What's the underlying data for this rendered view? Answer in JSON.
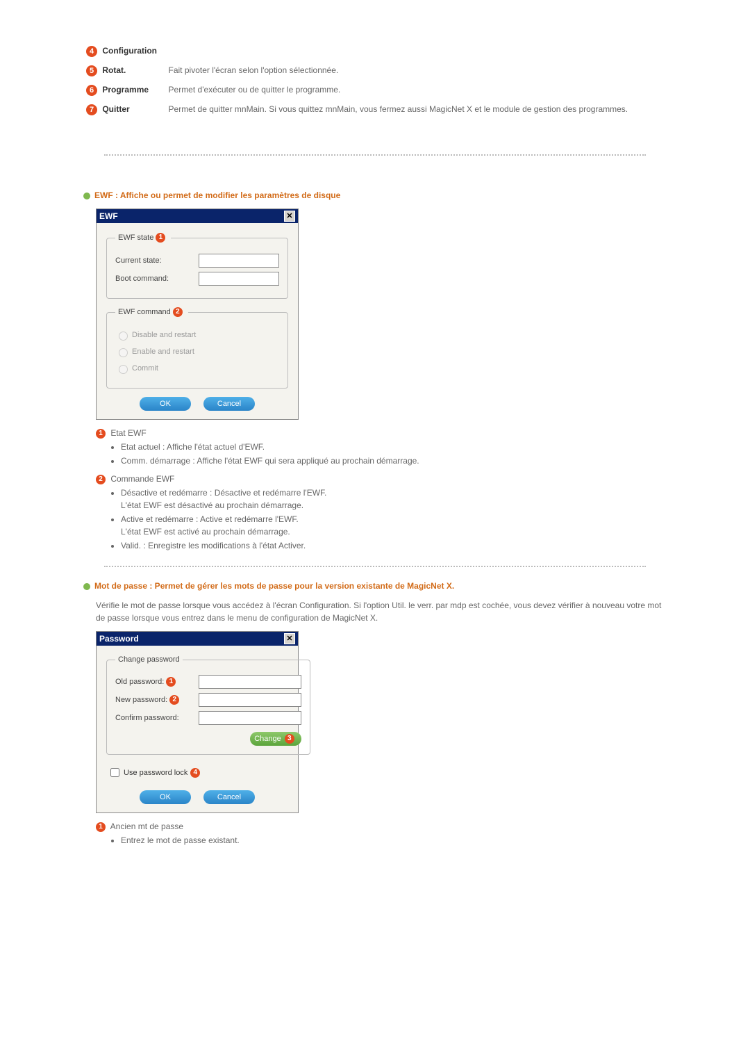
{
  "items": {
    "i4": {
      "num": "4",
      "label": "Configuration",
      "desc": ""
    },
    "i5": {
      "num": "5",
      "label": "Rotat.",
      "desc": "Fait pivoter l'écran selon l'option sélectionnée."
    },
    "i6": {
      "num": "6",
      "label": "Programme",
      "desc": "Permet d'exécuter ou de quitter le programme."
    },
    "i7": {
      "num": "7",
      "label": "Quitter",
      "desc": "Permet de quitter mnMain. Si vous quittez mnMain, vous fermez aussi MagicNet X et le module de gestion des programmes."
    }
  },
  "ewf": {
    "heading": "EWF : Affiche ou permet de modifier les paramètres de disque",
    "dialog": {
      "title": "EWF",
      "close_glyph": "✕",
      "group_state": {
        "legend": "EWF state",
        "legend_badge": "1",
        "current_state_label": "Current state:",
        "boot_command_label": "Boot command:"
      },
      "group_cmd": {
        "legend": "EWF command",
        "legend_badge": "2",
        "opt_disable": "Disable and restart",
        "opt_enable": "Enable and restart",
        "opt_commit": "Commit"
      },
      "ok_label": "OK",
      "cancel_label": "Cancel"
    },
    "notes": {
      "n1_badge": "1",
      "n1_title": "Etat EWF",
      "n1_b1": "Etat actuel : Affiche l'état actuel d'EWF.",
      "n1_b2": "Comm. démarrage : Affiche l'état EWF qui sera appliqué au prochain démarrage.",
      "n2_badge": "2",
      "n2_title": "Commande EWF",
      "n2_b1a": "Désactive et redémarre : Désactive et redémarre l'EWF.",
      "n2_b1b": "L'état EWF est désactivé au prochain démarrage.",
      "n2_b2a": "Active et redémarre : Active et redémarre l'EWF.",
      "n2_b2b": "L'état EWF est activé au prochain démarrage.",
      "n2_b3": "Valid. : Enregistre les modifications à l'état Activer."
    }
  },
  "password": {
    "heading": "Mot de passe : Permet de gérer les mots de passe pour la version existante de MagicNet X.",
    "body": "Vérifie le mot de passe lorsque vous accédez à l'écran Configuration. Si l'option Util. le verr. par mdp est cochée, vous devez vérifier à nouveau votre mot de passe lorsque vous entrez dans le menu de configuration de MagicNet X.",
    "dialog": {
      "title": "Password",
      "close_glyph": "✕",
      "group_legend": "Change password",
      "old_label": "Old password:",
      "old_badge": "1",
      "new_label": "New password:",
      "new_badge": "2",
      "confirm_label": "Confirm password:",
      "change_label": "Change",
      "change_badge": "3",
      "lock_label": "Use password lock",
      "lock_badge": "4",
      "ok_label": "OK",
      "cancel_label": "Cancel"
    },
    "notes": {
      "n1_badge": "1",
      "n1_title": "Ancien mt de passe",
      "n1_b1": "Entrez le mot de passe existant."
    }
  }
}
